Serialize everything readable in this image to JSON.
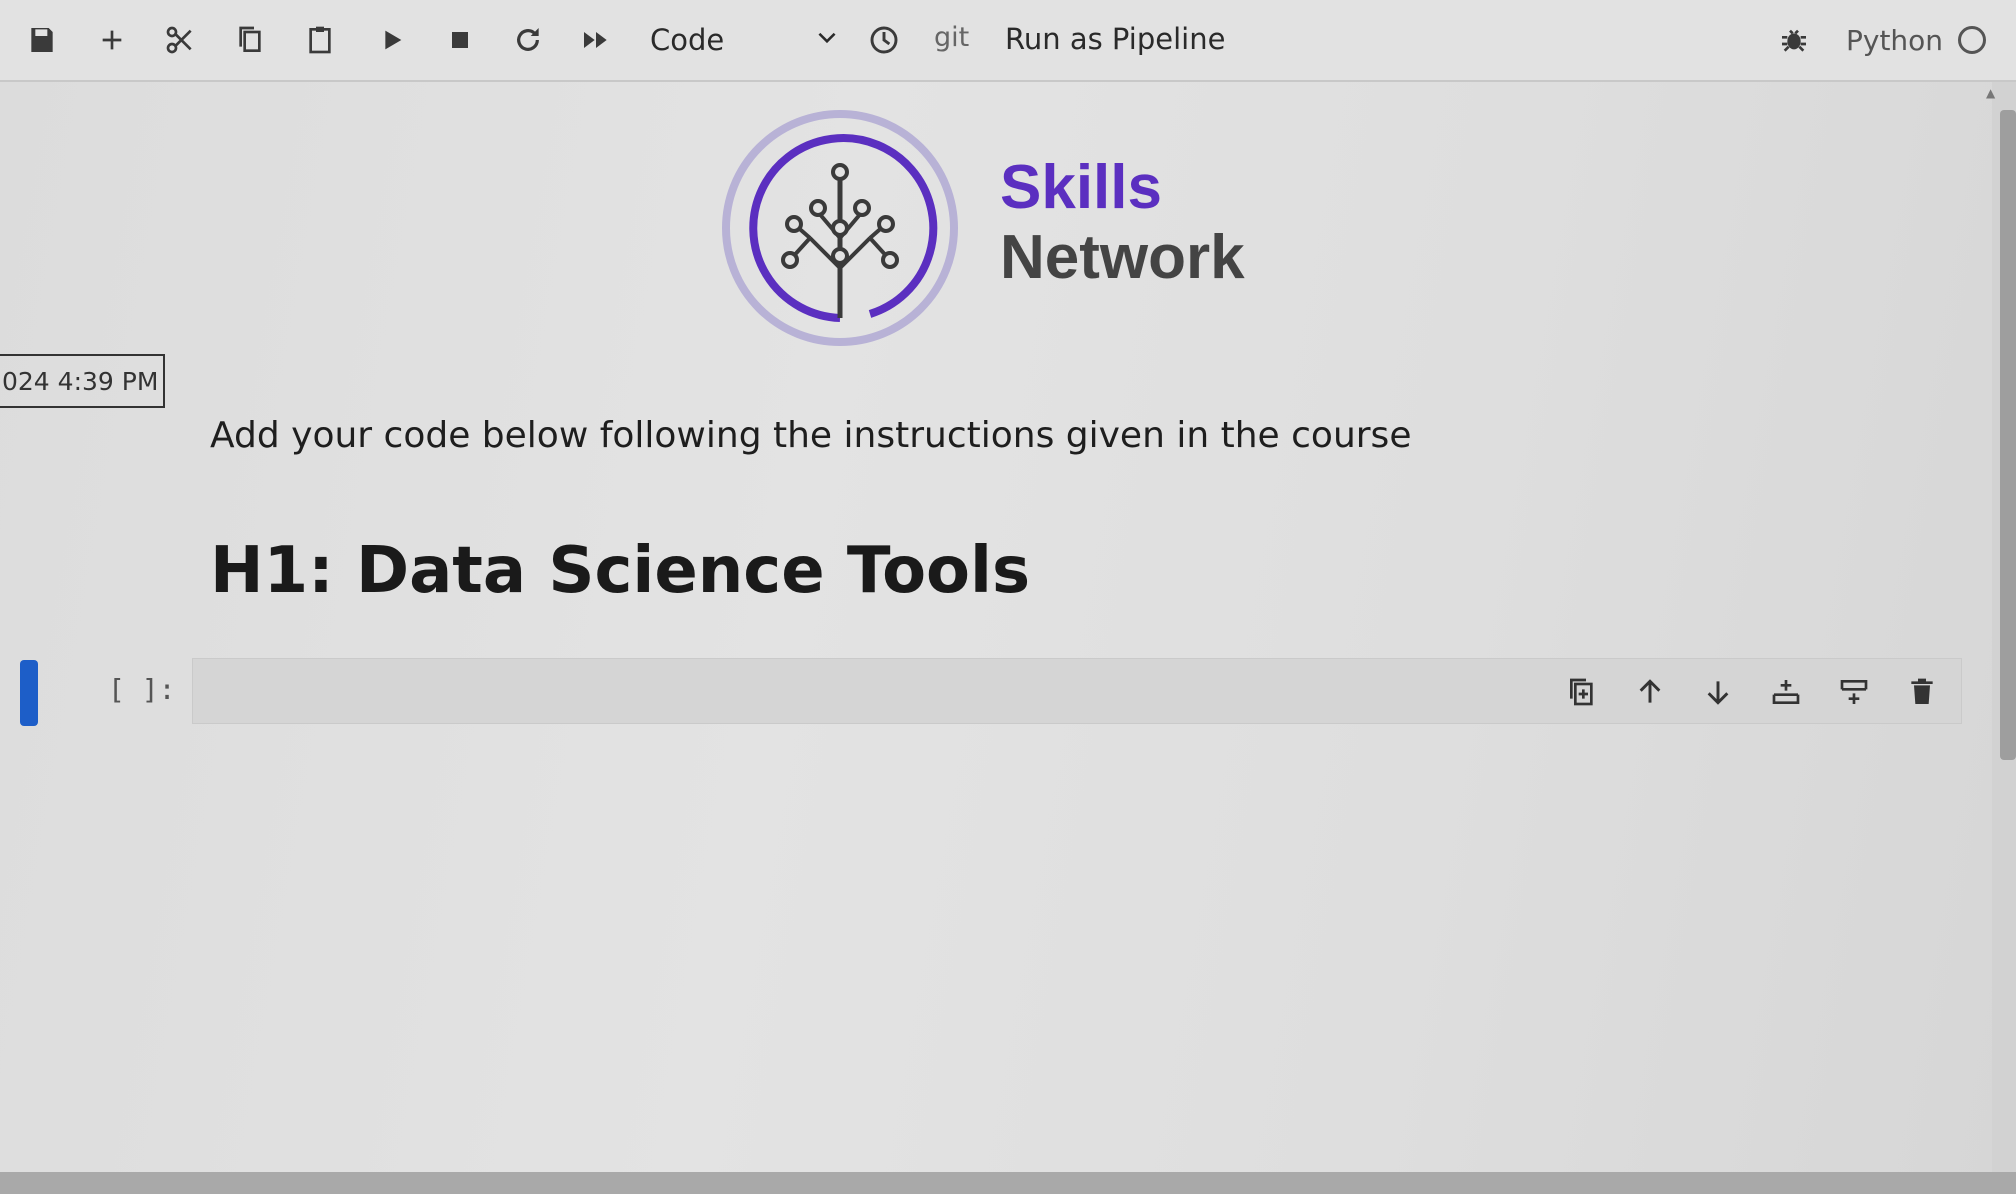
{
  "toolbar": {
    "cell_type": "Code",
    "git_label": "git",
    "pipeline_label": "Run as Pipeline",
    "kernel_name": "Python"
  },
  "notebook": {
    "logo": {
      "line1": "Skills",
      "line2": "Network",
      "brand_color": "#5b2fc0"
    },
    "timestamp": "024 4:39 PM",
    "instructions": "Add your code below following the instructions given in the course",
    "heading": "H1: Data Science Tools",
    "code_cell": {
      "prompt": "[ ]:",
      "content": ""
    }
  },
  "icons": [
    "save-icon",
    "add-cell-icon",
    "cut-icon",
    "copy-icon",
    "paste-icon",
    "run-icon",
    "stop-icon",
    "restart-icon",
    "run-all-icon",
    "chevron-down-icon",
    "history-icon",
    "debugger-icon",
    "kernel-status-icon",
    "duplicate-cell-icon",
    "move-up-icon",
    "move-down-icon",
    "insert-above-icon",
    "insert-below-icon",
    "delete-icon"
  ],
  "colors": {
    "active_cell_marker": "#1d5ec8"
  }
}
